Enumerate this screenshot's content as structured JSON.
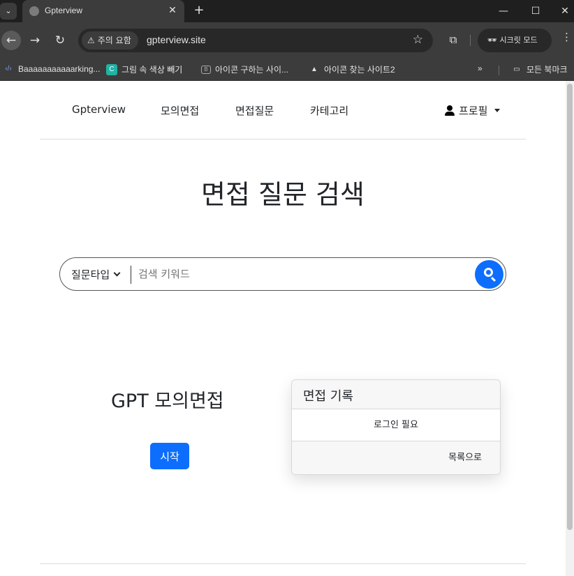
{
  "browser": {
    "tab_title": "Gpterview",
    "security_label": "주의 요함",
    "url": "gpterview.site",
    "incognito_label": "시크릿 모드",
    "bookmarks": [
      "Baaaaaaaaaaarking...",
      "그림 속 색상 빼기",
      "아이콘 구하는 사이...",
      "아이콘 찾는 사이트2"
    ],
    "all_bookmarks_label": "모든 북마크",
    "more_bookmarks": "»"
  },
  "nav": {
    "brand": "Gpterview",
    "links": [
      "모의면접",
      "면접질문",
      "카테고리"
    ],
    "profile_label": "프로필"
  },
  "main": {
    "title": "면접 질문 검색",
    "search": {
      "type_label": "질문타입",
      "placeholder": "검색 키워드"
    },
    "gpt_section": {
      "title": "GPT 모의면접",
      "start_label": "시작"
    },
    "records": {
      "title": "면접 기록",
      "body": "로그인 필요",
      "footer_link": "목록으로"
    }
  },
  "colors": {
    "primary": "#0d6efd",
    "browser_dark": "#1f1f1f",
    "toolbar": "#3c3c3c"
  }
}
